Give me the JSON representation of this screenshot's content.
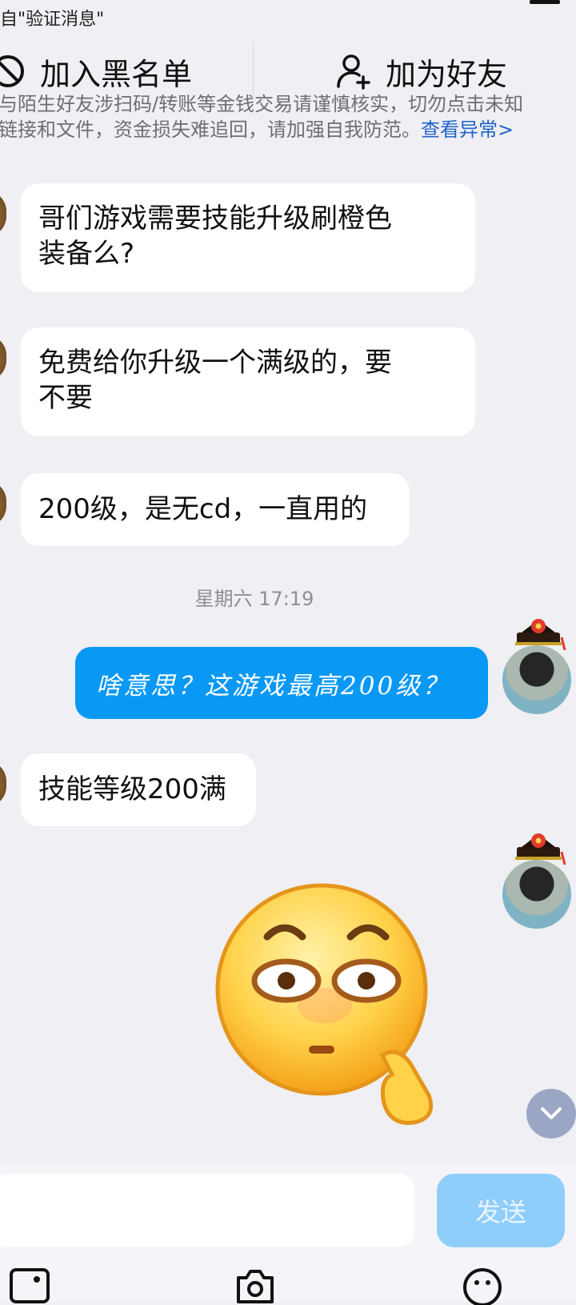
{
  "header": {
    "source_text": "自\"验证消息\""
  },
  "actions": {
    "block_label": "加入黑名单",
    "add_friend_label": "加为好友"
  },
  "warning": {
    "line1": "与陌生好友涉扫码/转账等金钱交易请谨慎核实，切勿点击未知",
    "line2": "链接和文件，资金损失难追回，请加强自我防范。",
    "link_text": "查看异常>"
  },
  "messages": [
    {
      "from": "other",
      "text_line1": "哥们游戏需要技能升级刷橙色",
      "text_line2": "装备么?"
    },
    {
      "from": "other",
      "text_line1": "免费给你升级一个满级的，要",
      "text_line2": "不要"
    },
    {
      "from": "other",
      "text": "200级，是无cd，一直用的"
    },
    {
      "from": "me",
      "text": "啥意思？这游戏最高200级？"
    },
    {
      "from": "other",
      "text": "技能等级200满"
    }
  ],
  "timestamp": "星期六 17:19",
  "input": {
    "placeholder": "",
    "send_label": "发送"
  },
  "toolbar": {
    "icons": [
      "image-icon",
      "camera-icon",
      "emoji-icon"
    ]
  },
  "colors": {
    "outgoing_bubble": "#0a98f5",
    "link": "#1f64c8",
    "send_button": "#8fcdfb"
  }
}
